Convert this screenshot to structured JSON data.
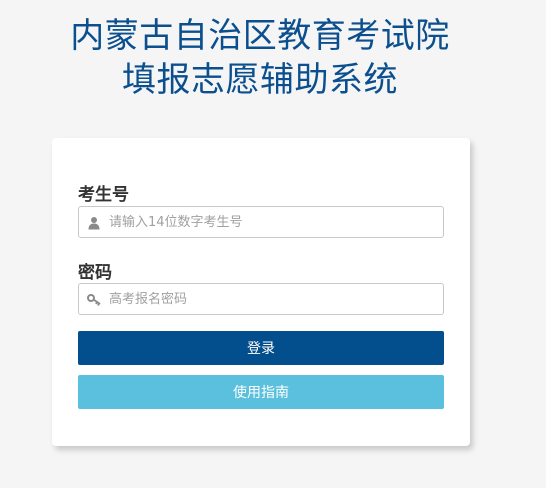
{
  "header": {
    "title_line1": "内蒙古自治区教育考试院",
    "title_line2": "填报志愿辅助系统"
  },
  "form": {
    "candidate_label": "考生号",
    "candidate_placeholder": "请输入14位数字考生号",
    "candidate_icon": "user-icon",
    "password_label": "密码",
    "password_placeholder": "高考报名密码",
    "password_icon": "key-icon",
    "login_button": "登录",
    "guide_button": "使用指南"
  },
  "colors": {
    "title": "#0b4f8f",
    "login_button": "#034e8c",
    "guide_button": "#5bc0de",
    "background": "#f5f5f5"
  }
}
